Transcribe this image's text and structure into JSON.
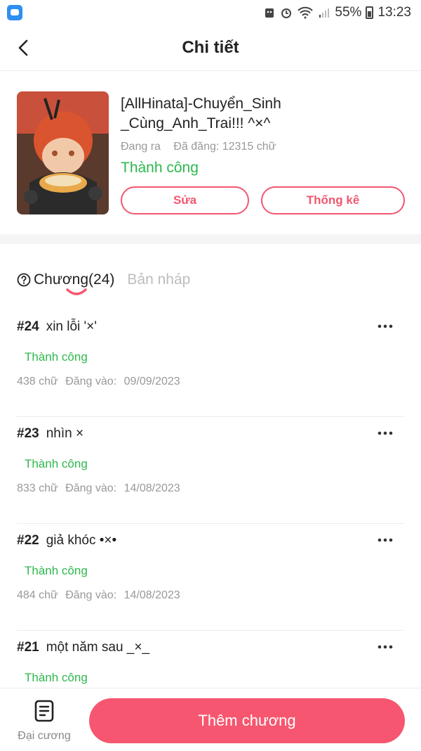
{
  "status_bar": {
    "battery": "55%",
    "time": "13:23"
  },
  "header": {
    "title": "Chi tiết"
  },
  "book": {
    "title": "[AllHinata]-Chuyển_Sinh_Cùng_Anh_Trai!!! ^×^",
    "state": "Đang ra",
    "word_count": "Đã đăng: 12315 chữ",
    "status": "Thành công",
    "edit_label": "Sửa",
    "stats_label": "Thống kê"
  },
  "tabs": {
    "chapters": "Chương(24)",
    "drafts": "Bản nháp"
  },
  "chapters": [
    {
      "number": "#24",
      "title": "xin lỗi '×'",
      "status": "Thành công",
      "words": "438 chữ",
      "posted_label": "Đăng vào:",
      "date": "09/09/2023"
    },
    {
      "number": "#23",
      "title": "nhìn ×",
      "status": "Thành công",
      "words": "833 chữ",
      "posted_label": "Đăng vào:",
      "date": "14/08/2023"
    },
    {
      "number": "#22",
      "title": "giả khóc •×•",
      "status": "Thành công",
      "words": "484 chữ",
      "posted_label": "Đăng vào:",
      "date": "14/08/2023"
    },
    {
      "number": "#21",
      "title": "một năm sau _×_",
      "status": "Thành công",
      "words": "",
      "posted_label": "",
      "date": ""
    }
  ],
  "bottom": {
    "outline_label": "Đại cương",
    "add_chapter_label": "Thêm chương"
  },
  "colors": {
    "accent": "#f6566f",
    "success": "#2db84d",
    "muted": "#999999"
  }
}
